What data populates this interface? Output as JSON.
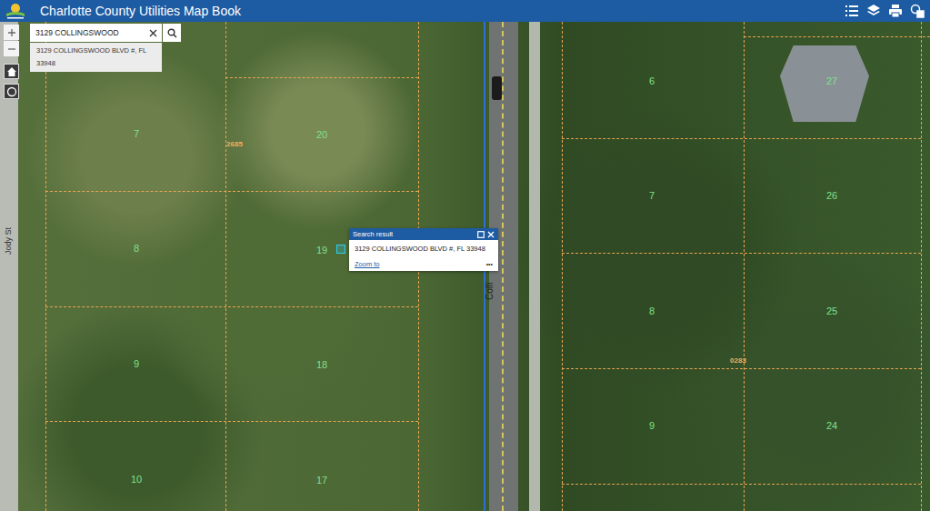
{
  "header": {
    "title": "Charlotte County Utilities Map Book"
  },
  "search": {
    "value": "3129 COLLINGSWOOD",
    "suggestions": [
      "3129 COLLINGSWOOD BLVD #, FL 33948"
    ]
  },
  "map": {
    "streets": [
      "Jody St",
      "Colli"
    ],
    "blocks": [
      "2685",
      "0283"
    ],
    "lots": [
      "7",
      "20",
      "8",
      "19",
      "9",
      "18",
      "10",
      "17",
      "6",
      "27",
      "7",
      "26",
      "8",
      "25",
      "9",
      "24"
    ]
  },
  "popup": {
    "title": "Search result",
    "address": "3129 COLLINGSWOOD BLVD #, FL 33948",
    "link": "Zoom to",
    "more": "•••"
  }
}
